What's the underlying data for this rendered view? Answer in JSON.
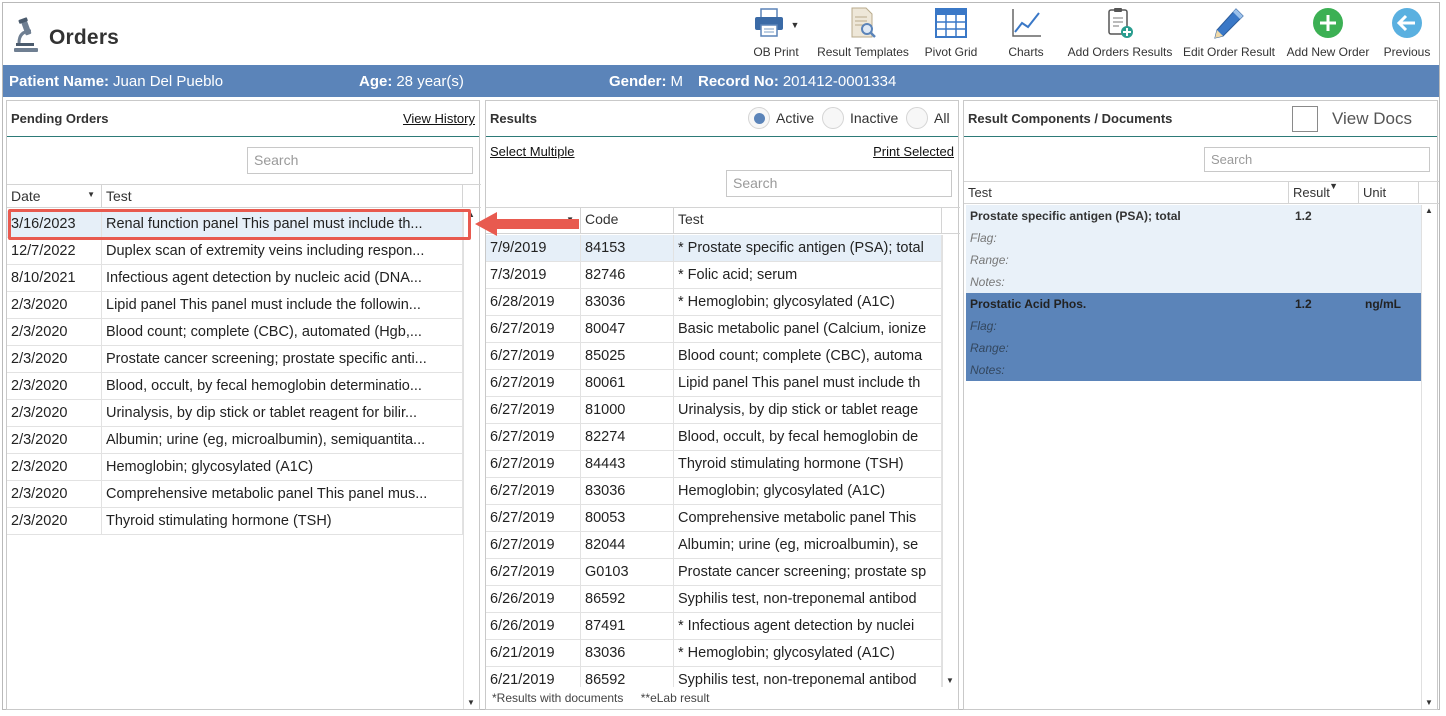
{
  "app": {
    "title": "Orders"
  },
  "toolbar": [
    {
      "name": "ob-print",
      "label": "OB Print",
      "icon": "printer-icon"
    },
    {
      "name": "result-templates",
      "label": "Result Templates",
      "icon": "document-search-icon"
    },
    {
      "name": "pivot-grid",
      "label": "Pivot Grid",
      "icon": "grid-icon"
    },
    {
      "name": "charts",
      "label": "Charts",
      "icon": "line-chart-icon"
    },
    {
      "name": "add-orders-results",
      "label": "Add Orders Results",
      "icon": "clipboard-add-icon"
    },
    {
      "name": "edit-order-result",
      "label": "Edit Order Result",
      "icon": "pencil-icon"
    },
    {
      "name": "add-new-order",
      "label": "Add New Order",
      "icon": "plus-circle-icon"
    },
    {
      "name": "previous",
      "label": "Previous",
      "icon": "arrow-left-circle-icon"
    }
  ],
  "patient": {
    "name_label": "Patient Name:",
    "name_value": "Juan Del Pueblo",
    "age_label": "Age:",
    "age_value": "28 year(s)",
    "gender_label": "Gender:",
    "gender_value": "M",
    "record_label": "Record No:",
    "record_value": "201412-0001334"
  },
  "pending": {
    "title": "Pending Orders",
    "view_history": "View History",
    "search_placeholder": "Search",
    "columns": [
      "Date",
      "Test"
    ],
    "rows": [
      {
        "date": "3/16/2023",
        "test": "Renal function panel This panel must include th..."
      },
      {
        "date": "12/7/2022",
        "test": "Duplex scan of extremity veins including respon..."
      },
      {
        "date": "8/10/2021",
        "test": "Infectious agent detection by nucleic acid (DNA..."
      },
      {
        "date": "2/3/2020",
        "test": "Lipid panel This panel must include the followin..."
      },
      {
        "date": "2/3/2020",
        "test": "Blood count; complete (CBC), automated (Hgb,..."
      },
      {
        "date": "2/3/2020",
        "test": "Prostate cancer screening; prostate specific anti..."
      },
      {
        "date": "2/3/2020",
        "test": "Blood, occult, by fecal hemoglobin determinatio..."
      },
      {
        "date": "2/3/2020",
        "test": "Urinalysis, by dip stick or tablet reagent for bilir..."
      },
      {
        "date": "2/3/2020",
        "test": "Albumin; urine (eg, microalbumin), semiquantita..."
      },
      {
        "date": "2/3/2020",
        "test": "Hemoglobin; glycosylated (A1C)"
      },
      {
        "date": "2/3/2020",
        "test": "Comprehensive metabolic panel This panel mus..."
      },
      {
        "date": "2/3/2020",
        "test": "Thyroid stimulating hormone (TSH)"
      }
    ]
  },
  "results": {
    "title": "Results",
    "filters": [
      "Active",
      "Inactive",
      "All"
    ],
    "select_multiple": "Select Multiple",
    "print_selected": "Print Selected",
    "search_placeholder": "Search",
    "columns": [
      "Code",
      "Test"
    ],
    "rows": [
      {
        "date": "7/9/2019",
        "code": "84153",
        "test": "* Prostate specific antigen (PSA); total"
      },
      {
        "date": "7/3/2019",
        "code": "82746",
        "test": "* Folic acid; serum"
      },
      {
        "date": "6/28/2019",
        "code": "83036",
        "test": "* Hemoglobin; glycosylated (A1C)"
      },
      {
        "date": "6/27/2019",
        "code": "80047",
        "test": "Basic metabolic panel (Calcium, ionize"
      },
      {
        "date": "6/27/2019",
        "code": "85025",
        "test": "Blood count; complete (CBC), automa"
      },
      {
        "date": "6/27/2019",
        "code": "80061",
        "test": "Lipid panel This panel must include th"
      },
      {
        "date": "6/27/2019",
        "code": "81000",
        "test": "Urinalysis, by dip stick or tablet reage"
      },
      {
        "date": "6/27/2019",
        "code": "82274",
        "test": "Blood, occult, by fecal hemoglobin de"
      },
      {
        "date": "6/27/2019",
        "code": "84443",
        "test": "Thyroid stimulating hormone (TSH)"
      },
      {
        "date": "6/27/2019",
        "code": "83036",
        "test": "Hemoglobin; glycosylated (A1C)"
      },
      {
        "date": "6/27/2019",
        "code": "80053",
        "test": "Comprehensive metabolic panel This"
      },
      {
        "date": "6/27/2019",
        "code": "82044",
        "test": "Albumin; urine (eg, microalbumin), se"
      },
      {
        "date": "6/27/2019",
        "code": "G0103",
        "test": "Prostate cancer screening; prostate sp"
      },
      {
        "date": "6/26/2019",
        "code": "86592",
        "test": "Syphilis test, non-treponemal antibod"
      },
      {
        "date": "6/26/2019",
        "code": "87491",
        "test": "* Infectious agent detection by nuclei"
      },
      {
        "date": "6/21/2019",
        "code": "83036",
        "test": "* Hemoglobin; glycosylated (A1C)"
      },
      {
        "date": "6/21/2019",
        "code": "86592",
        "test": "Syphilis test, non-treponemal antibod"
      }
    ],
    "footer_note1": "*Results with documents",
    "footer_note2": "**eLab result"
  },
  "components": {
    "title": "Result Components / Documents",
    "view_docs": "View Docs",
    "search_placeholder": "Search",
    "columns": [
      "Test",
      "Result",
      "Unit"
    ],
    "items": [
      {
        "test": "Prostate specific antigen (PSA); total",
        "result": "1.2",
        "unit": "",
        "flag": "Flag:",
        "range": "Range:",
        "notes": "Notes:"
      },
      {
        "test": "Prostatic Acid Phos.",
        "result": "1.2",
        "unit": "ng/mL",
        "flag": "Flag:",
        "range": "Range:",
        "notes": "Notes:"
      }
    ]
  },
  "colors": {
    "accent": "#5b84b9",
    "callout": "#e85a4f",
    "green": "#3cb054",
    "teal": "#2d7a78"
  }
}
